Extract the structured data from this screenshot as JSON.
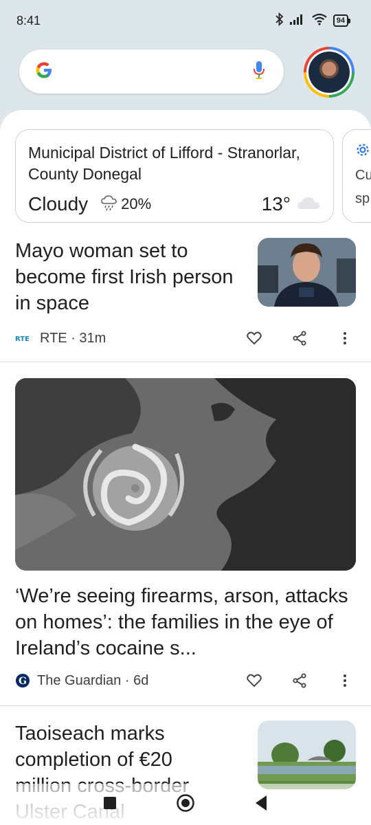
{
  "status_bar": {
    "time": "8:41",
    "battery": "94"
  },
  "search": {
    "logo": "G",
    "mic_icon": "mic-icon"
  },
  "weather": {
    "location": "Municipal District of Lifford - Stranorlar, County Donegal",
    "condition": "Cloudy",
    "precip": "20%",
    "temperature": "13°"
  },
  "side_card": {
    "text_line1": "Cu",
    "text_line2": "sp"
  },
  "articles": [
    {
      "headline": "Mayo woman set to become first Irish person in space",
      "source": "RTE",
      "source_logo": "RTE",
      "age": "31m",
      "meta": "RTE · 31m"
    },
    {
      "headline": "‘We’re seeing firearms, arson, attacks on homes’: the families in the eye of Ireland’s cocaine s...",
      "source": "The Guardian",
      "age": "6d",
      "meta": "The Guardian · 6d"
    },
    {
      "headline": "Taoiseach marks completion of €20 million cross-border Ulster Canal"
    }
  ],
  "colors": {
    "google_blue": "#4285f4",
    "google_red": "#ea4335",
    "google_yellow": "#fbbc05",
    "google_green": "#34a853",
    "background": "#dde6ea"
  }
}
